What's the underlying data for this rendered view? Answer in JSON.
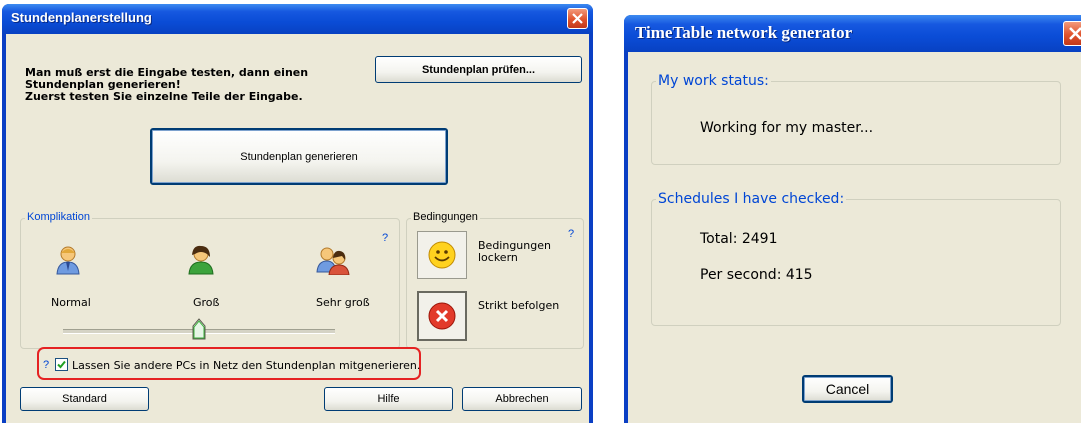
{
  "left_window": {
    "title": "Stundenplanerstellung",
    "intro": [
      "Man muß erst die Eingabe testen, dann einen",
      "Stundenplan generieren!",
      "Zuerst testen Sie einzelne Teile der Eingabe."
    ],
    "check_button": "Stundenplan prüfen...",
    "generate_button": "Stundenplan generieren",
    "complication": {
      "label": "Komplikation",
      "help": "?",
      "levels": [
        "Normal",
        "Groß",
        "Sehr groß"
      ],
      "slider_level": 0.5
    },
    "conditions": {
      "label": "Bedingungen",
      "help": "?",
      "relax_label": [
        "Bedingungen",
        "lockern"
      ],
      "strict_label": "Strikt befolgen"
    },
    "network": {
      "help": "?",
      "checked": true,
      "label": "Lassen Sie andere PCs in Netz den Stundenplan mitgenerieren."
    },
    "buttons": {
      "standard": "Standard",
      "help": "Hilfe",
      "cancel": "Abbrechen"
    },
    "highlight_color": "#e52222"
  },
  "right_window": {
    "title": "TimeTable network generator",
    "status": {
      "label": "My work status:",
      "text": "Working for my master..."
    },
    "checked": {
      "label": "Schedules I have checked:",
      "total": "Total: 2491",
      "per_second": "Per second: 415"
    },
    "cancel_button": "Cancel"
  }
}
